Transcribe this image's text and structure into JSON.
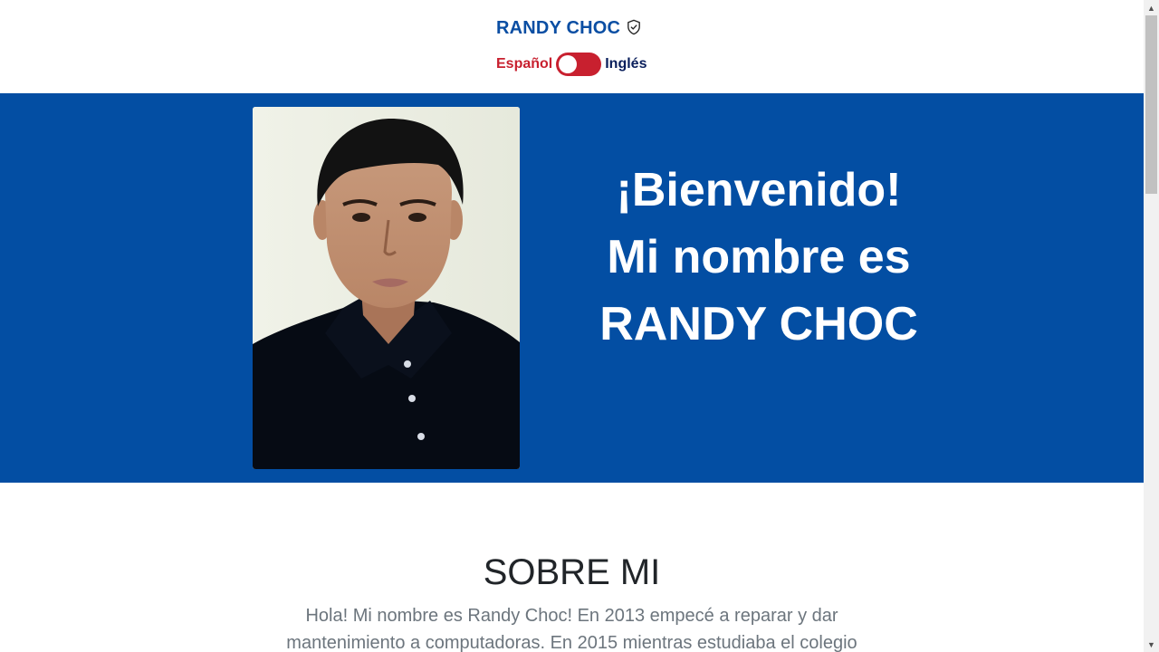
{
  "header": {
    "brand": "RANDY CHOC",
    "brand_icon": "shield-check-icon",
    "lang_left": "Español",
    "lang_right": "Inglés"
  },
  "hero": {
    "line1": "¡Bienvenido!",
    "line2": "Mi nombre es",
    "line3": "RANDY CHOC"
  },
  "about": {
    "title": "SOBRE MI",
    "body": "Hola! Mi nombre es Randy Choc! En 2013 empecé a reparar y dar mantenimiento a computadoras. En 2015 mientras estudiaba el colegio"
  },
  "colors": {
    "brand_blue": "#034ea3",
    "accent_red": "#c8202f",
    "dark_navy": "#0a1f5c"
  }
}
